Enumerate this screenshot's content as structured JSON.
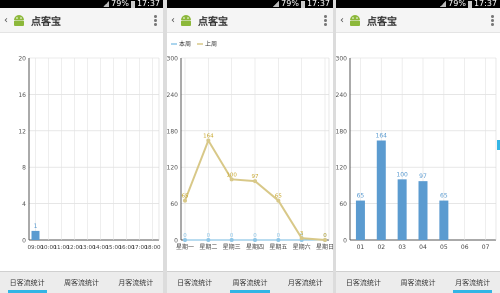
{
  "status_bar": {
    "time": "17:37",
    "battery": "79%"
  },
  "app": {
    "title": "点客宝",
    "back_glyph": "‹"
  },
  "tabs": [
    "日客流统计",
    "周客流统计",
    "月客流统计"
  ],
  "colors": {
    "accent": "#33b5e5",
    "this_week": "#8fc7e8",
    "last_week": "#d8c888",
    "bar": "#5b9bd0",
    "label_gold": "#c8a830"
  },
  "panels": [
    {
      "active_tab": 0,
      "chart_data": {
        "type": "bar",
        "categories": [
          "09:00",
          "10:00",
          "11:00",
          "12:00",
          "13:00",
          "14:00",
          "15:00",
          "16:00",
          "17:00",
          "18:00"
        ],
        "values": [
          1,
          0,
          0,
          0,
          0,
          0,
          0,
          0,
          0,
          0
        ],
        "value_labels": [
          "1",
          "",
          "",
          "",
          "",
          "",
          "",
          "",
          "",
          ""
        ],
        "ylim": [
          0,
          20
        ],
        "yticks": [
          0,
          4,
          8,
          12,
          16,
          20
        ],
        "grid": true
      }
    },
    {
      "active_tab": 1,
      "chart_data": {
        "type": "line",
        "categories": [
          "星期一",
          "星期二",
          "星期三",
          "星期四",
          "星期五",
          "星期六",
          "星期日"
        ],
        "series": [
          {
            "name": "本周",
            "values": [
              0,
              0,
              0,
              0,
              0,
              0,
              0
            ]
          },
          {
            "name": "上周",
            "values": [
              65,
              164,
              100,
              97,
              65,
              3,
              0
            ]
          }
        ],
        "ylim": [
          0,
          300
        ],
        "yticks": [
          0,
          60,
          120,
          180,
          240,
          300
        ],
        "grid": true,
        "legend": "top-left"
      }
    },
    {
      "active_tab": 2,
      "chart_data": {
        "type": "bar",
        "categories": [
          "01",
          "02",
          "03",
          "04",
          "05",
          "06",
          "07"
        ],
        "values": [
          65,
          164,
          100,
          97,
          65,
          0,
          0
        ],
        "value_labels": [
          "65",
          "164",
          "100",
          "97",
          "65",
          "",
          ""
        ],
        "ylim": [
          0,
          300
        ],
        "yticks": [
          0,
          60,
          120,
          180,
          240,
          300
        ],
        "grid": true
      }
    }
  ]
}
